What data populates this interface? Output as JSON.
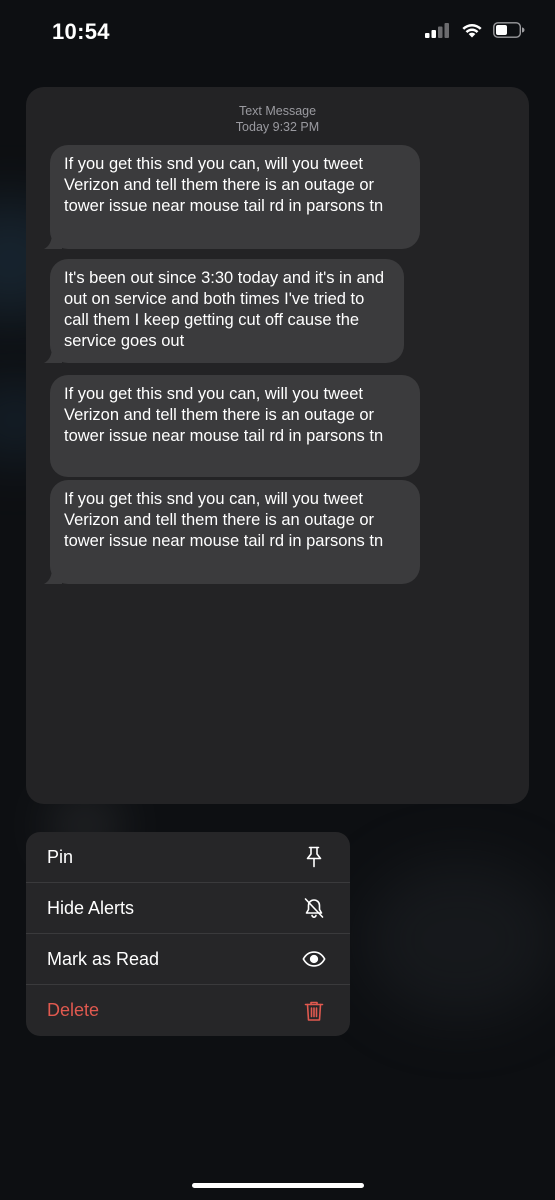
{
  "status_bar": {
    "time": "10:54"
  },
  "conversation": {
    "header_type": "Text Message",
    "header_time": "Today 9:32 PM",
    "messages": [
      "If you get this snd you can, will you tweet Verizon and tell them there is an outage or tower issue near mouse tail rd in parsons tn",
      "It's been out since 3:30 today and it's in and out on service and both times I've tried to call them I keep getting cut off cause the service goes out",
      "If you get this snd you can, will you tweet Verizon and tell them there is an outage or tower issue near mouse tail rd in parsons tn",
      "If you get this snd you can, will you tweet Verizon and tell them there is an outage or tower issue near mouse tail rd in parsons tn"
    ]
  },
  "menu": {
    "items": [
      {
        "label": "Pin",
        "icon": "pin-icon"
      },
      {
        "label": "Hide Alerts",
        "icon": "bell-slash-icon"
      },
      {
        "label": "Mark as Read",
        "icon": "eye-icon"
      },
      {
        "label": "Delete",
        "icon": "trash-icon"
      }
    ]
  },
  "colors": {
    "background": "#0d0f12",
    "card": "#232325",
    "bubble": "#3b3b3d",
    "menu": "#262628",
    "destructive": "#e0594f"
  }
}
